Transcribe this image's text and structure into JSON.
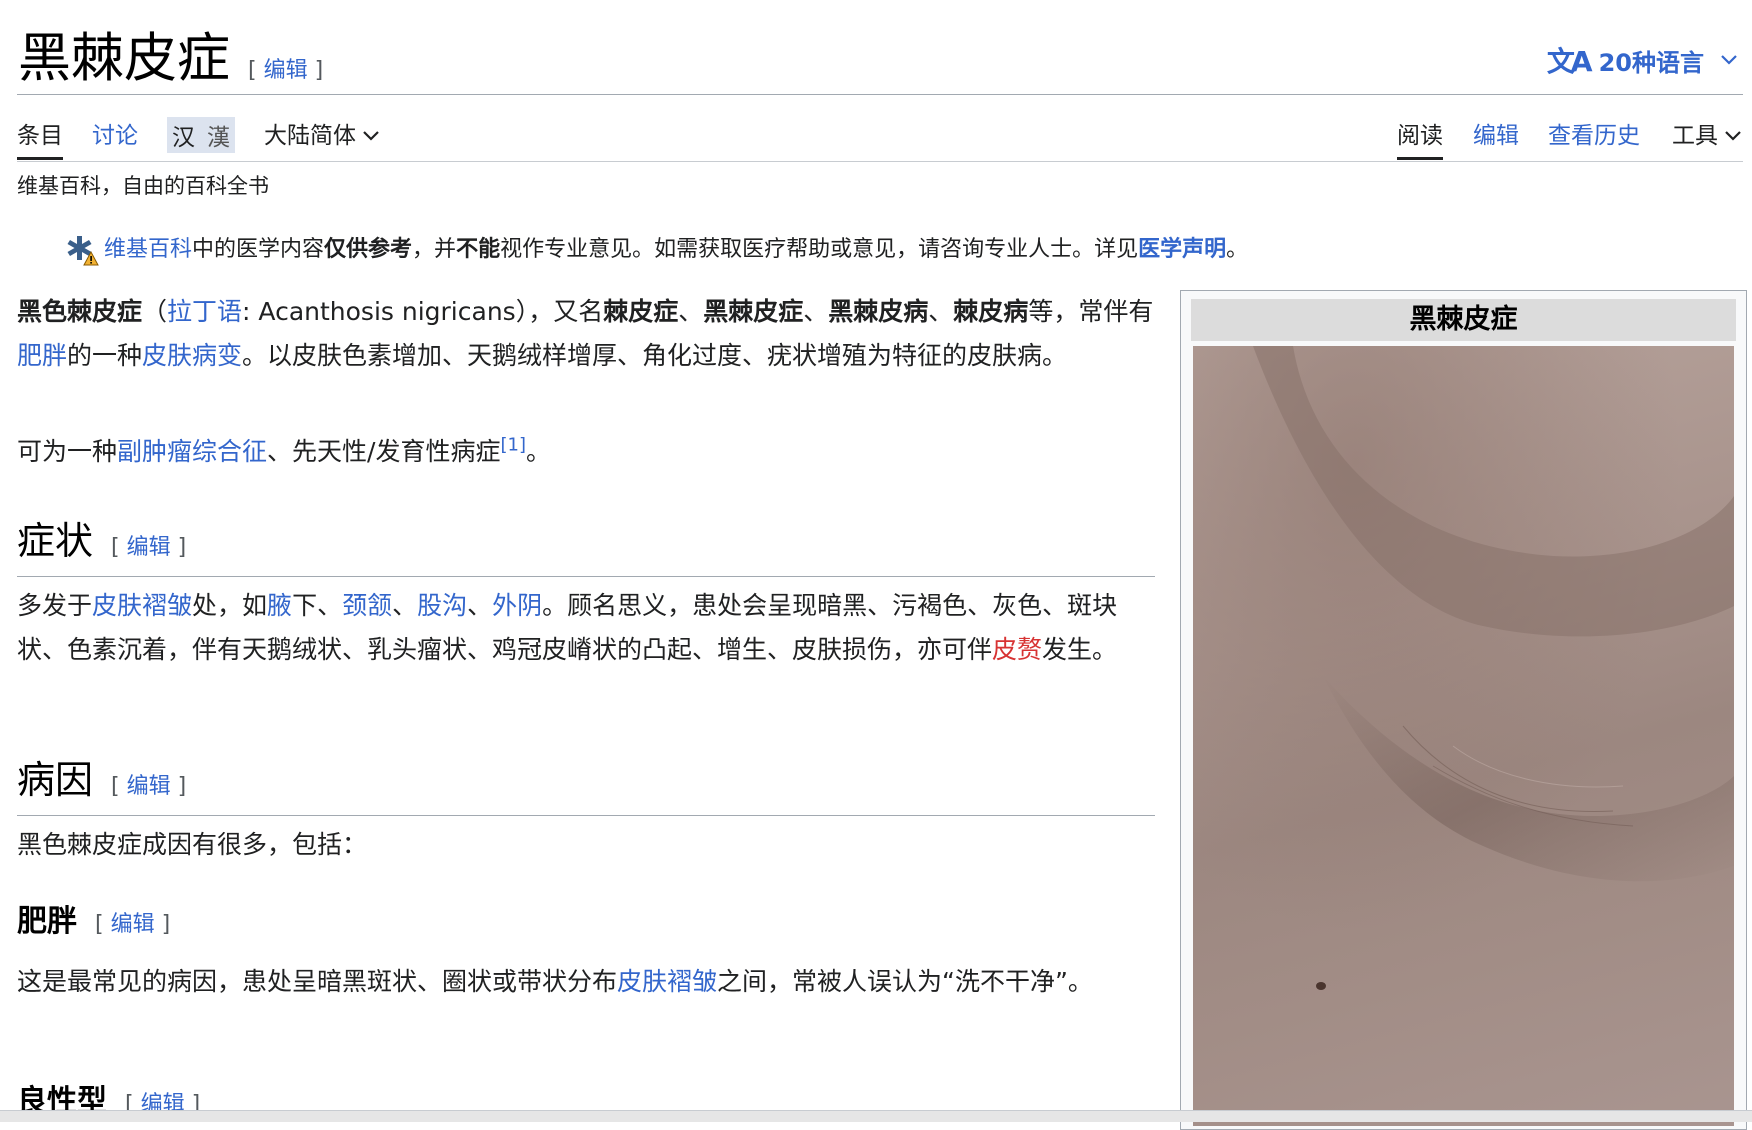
{
  "header": {
    "title": "黑棘皮症",
    "edit_label": "编辑",
    "languages_label": "20种语言",
    "languages_icon": "translate-icon"
  },
  "tabs": {
    "article": "条目",
    "talk": "讨论",
    "variant_simplified": "汉",
    "variant_traditional": "漢",
    "variant_region": "大陆简体",
    "read": "阅读",
    "edit": "编辑",
    "history": "查看历史",
    "tools": "工具"
  },
  "tagline": "维基百科，自由的百科全书",
  "notice": {
    "icon": "medical-warning-icon",
    "link_wikipedia": "维基百科",
    "text1": "中的医学内容",
    "bold1": "仅供参考",
    "text2": "，并",
    "bold2": "不能",
    "text3": "视作专业意见。如需获取医疗帮助或意见，请咨询专业人士。详见",
    "link_disclaimer": "医学声明",
    "text4": "。"
  },
  "lead": {
    "p1_b1": "黑色棘皮症",
    "p1_t1": "（",
    "p1_link_latin": "拉丁语",
    "p1_t2": ": Acanthosis nigricans），又名",
    "p1_b2": "棘皮症",
    "p1_t3": "、",
    "p1_b3": "黑棘皮症",
    "p1_t4": "、",
    "p1_b4": "黑棘皮病",
    "p1_t5": "、",
    "p1_b5": "棘皮病",
    "p1_t6": "等，常伴有",
    "p1_link_obesity": "肥胖",
    "p1_t7": "的一种",
    "p1_link_lesion": "皮肤病变",
    "p1_t8": "。以皮肤色素增加、天鹅绒样增厚、角化过度、疣状增殖为特征的皮肤病。",
    "p2_t1": "可为一种",
    "p2_link": "副肿瘤综合征",
    "p2_t2": "、先天性/发育性病症",
    "p2_ref": "[1]",
    "p2_t3": "。"
  },
  "sections": {
    "symptoms": {
      "heading": "症状",
      "t1": "多发于",
      "l1": "皮肤褶皱",
      "t2": "处，如",
      "l2": "腋",
      "t3": "下、",
      "l3": "颈颔",
      "t4": "、",
      "l4": "股沟",
      "t5": "、",
      "l5": "外阴",
      "t6": "。顾名思义，患处会呈现暗黑、污褐色、灰色、斑块状、色素沉着，伴有天鹅绒状、乳头瘤状、鸡冠皮嵴状的凸起、增生、皮肤损伤，亦可伴",
      "l6_red": "皮赘",
      "t7": "发生。"
    },
    "causes": {
      "heading": "病因",
      "intro": "黑色棘皮症成因有很多，包括："
    },
    "obesity": {
      "heading": "肥胖",
      "t1": "这是最常见的病因，患处呈暗黑斑状、圈状或带状分布",
      "l1": "皮肤褶皱",
      "t2": "之间，常被人误认为“洗不干净”。"
    },
    "benign": {
      "heading": "良性型"
    }
  },
  "infobox": {
    "title": "黑棘皮症"
  },
  "colors": {
    "link": "#3366cc",
    "redlink": "#d73333",
    "text": "#202122",
    "variant_bg": "#dce3ef"
  }
}
